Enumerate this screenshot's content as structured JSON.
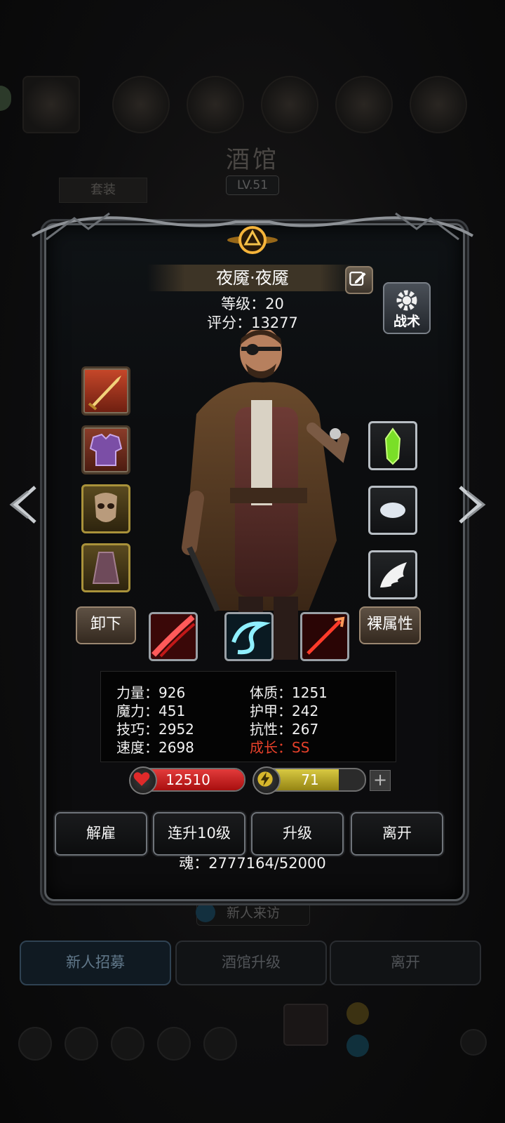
{
  "background": {
    "title": "酒馆",
    "level": "LV.51",
    "tab_suit": "套装",
    "visit_label": "新人来访",
    "buttons": [
      "新人招募",
      "酒馆升级",
      "离开"
    ]
  },
  "hero": {
    "name": "夜魇·夜魇",
    "level_label": "等级：20",
    "score_label": "评分：13277",
    "tactics_label": "战术"
  },
  "left_slots": [
    "sword",
    "armor",
    "mask",
    "cloak"
  ],
  "right_slots": [
    "green-crystal",
    "white-stone",
    "wing"
  ],
  "buttons": {
    "unequip": "卸下",
    "base_attr": "裸属性"
  },
  "skills": [
    "red-slash",
    "cyan-whirl",
    "red-spear"
  ],
  "stats": {
    "strength": "力量：926",
    "magic": "魔力：451",
    "skill": "技巧：2952",
    "speed": "速度：2698",
    "constitution": "体质：1251",
    "armor": "护甲：242",
    "resistance": "抗性：267",
    "growth": "成长：SS"
  },
  "hp": {
    "value": "12510",
    "fill_fraction": 1.0
  },
  "energy": {
    "value": "71",
    "fill_fraction": 0.76
  },
  "plus_label": "+",
  "actions": {
    "dismiss": "解雇",
    "level10": "连升10级",
    "upgrade": "升级",
    "leave": "离开"
  },
  "soul_label": "魂：2777164/52000",
  "colors": {
    "growth": "#e5402a",
    "hp": "#d62727",
    "energy": "#c9b630"
  }
}
